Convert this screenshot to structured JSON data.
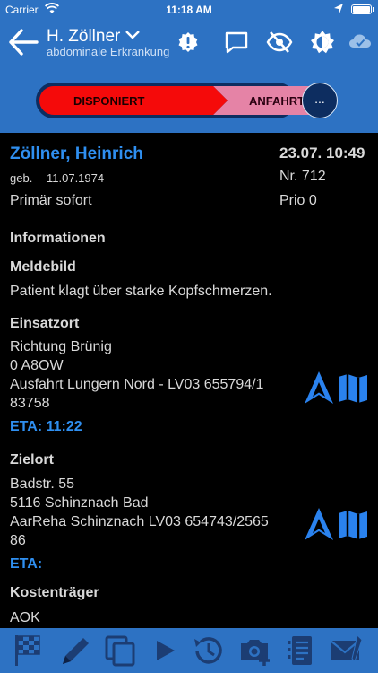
{
  "status_bar": {
    "carrier": "Carrier",
    "time": "11:18 AM"
  },
  "nav": {
    "title": "H. Zöllner",
    "subtitle": "abdominale Erkrankung",
    "icons": [
      "back-arrow-icon",
      "alert-badge-icon",
      "chat-icon",
      "eye-off-icon",
      "brightness-icon",
      "cloud-check-icon"
    ]
  },
  "stages": {
    "current": "DISPONIERT",
    "next": "ANFAHRT",
    "more": "..."
  },
  "patient": {
    "name": "Zöllner, Heinrich",
    "datetime": "23.07. 10:49",
    "geb_label": "geb.",
    "geb_date": "11.07.1974",
    "nr": "Nr. 712",
    "priority_category": "Primär sofort",
    "prio": "Prio  0"
  },
  "informationen": {
    "heading": "Informationen"
  },
  "meldebild": {
    "heading": "Meldebild",
    "text": "Patient klagt über starke Kopfschmerzen."
  },
  "einsatzort": {
    "heading": "Einsatzort",
    "line1": "Richtung Brünig",
    "line2": "0 A8OW",
    "line3": "Ausfahrt Lungern Nord -  LV03 655794/1",
    "line4": "83758",
    "eta": "ETA: 11:22"
  },
  "zielort": {
    "heading": "Zielort",
    "line1": "Badstr. 55",
    "line2": "5116 Schinznach Bad",
    "line3": "AarReha Schinznach LV03 654743/2565",
    "line4": "86",
    "eta": "ETA:"
  },
  "kostentraeger": {
    "heading": "Kostenträger",
    "value": "AOK"
  },
  "tabbar": {
    "icons": [
      "checkered-flag-icon",
      "pencil-icon",
      "copy-icon",
      "play-icon",
      "history-icon",
      "camera-add-icon",
      "notes-icon",
      "mail-icon"
    ]
  },
  "colors": {
    "bar": "#2d72c3",
    "accent": "#2f8ff0",
    "stage_current": "#f50a0a",
    "stage_next": "#e583a6"
  }
}
